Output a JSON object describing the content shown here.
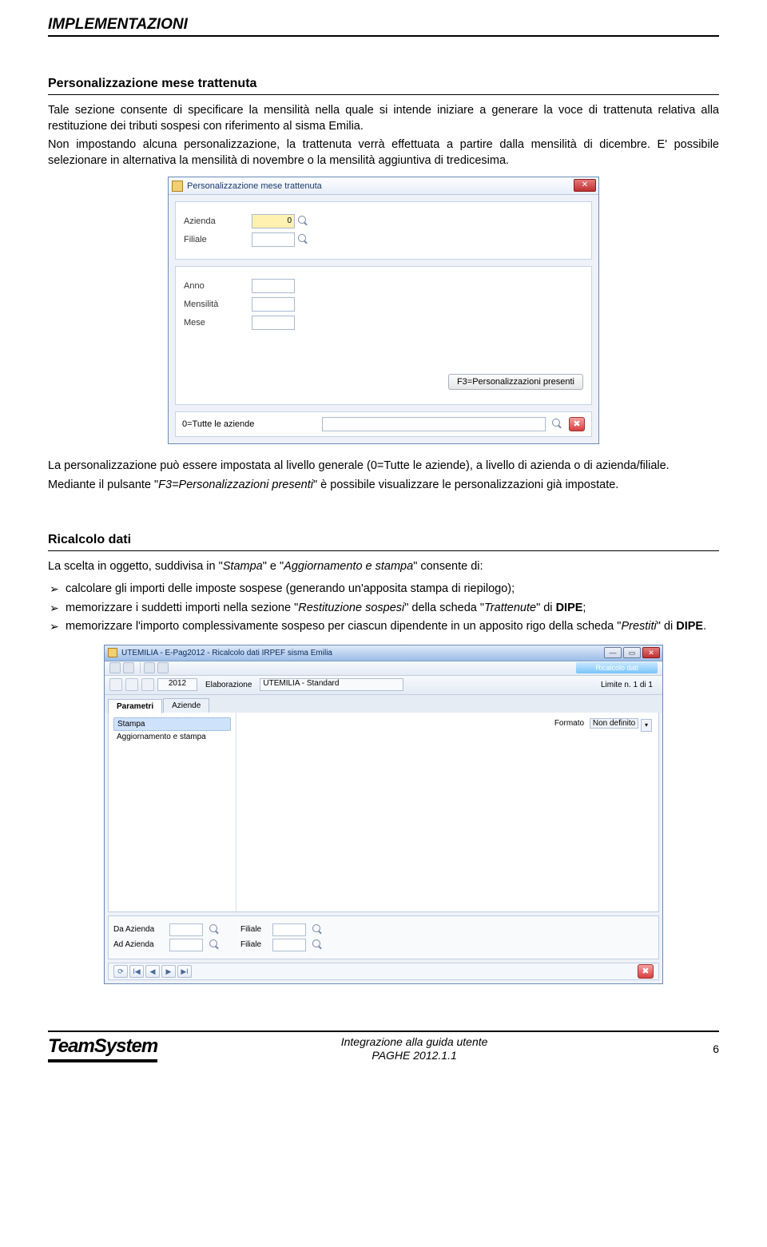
{
  "header": {
    "title": "IMPLEMENTAZIONI"
  },
  "section1": {
    "title": "Personalizzazione mese trattenuta",
    "para1": "Tale sezione consente di specificare la mensilità nella quale si intende iniziare a generare la voce di trattenuta relativa alla restituzione dei tributi sospesi con riferimento al sisma Emilia.",
    "para2": "Non impostando alcuna personalizzazione, la trattenuta verrà effettuata a partire dalla mensilità di dicembre. E' possibile selezionare in alternativa la mensilità di novembre o la mensilità aggiuntiva di tredicesima.",
    "after1": "La personalizzazione può essere impostata al livello generale (0=Tutte le aziende), a livello di azienda o di azienda/filiale.",
    "after2_pre": "Mediante il pulsante \"",
    "after2_btn": "F3=Personalizzazioni presenti",
    "after2_post": "\" è possibile visualizzare le personalizzazioni già impostate."
  },
  "dialog1": {
    "title": "Personalizzazione mese trattenuta",
    "labels": {
      "azienda": "Azienda",
      "filiale": "Filiale",
      "anno": "Anno",
      "mensilita": "Mensilità",
      "mese": "Mese"
    },
    "azienda_value": "0",
    "f3_button": "F3=Personalizzazioni presenti",
    "footer_text": "0=Tutte le aziende"
  },
  "section2": {
    "title": "Ricalcolo dati",
    "intro_pre": "La scelta in oggetto, suddivisa in \"",
    "intro_i1": "Stampa",
    "intro_mid": "\" e \"",
    "intro_i2": "Aggiornamento e stampa",
    "intro_post": "\" consente di:",
    "bullets": {
      "b1": "calcolare gli importi delle imposte sospese (generando un'apposita stampa di riepilogo);",
      "b2_pre": "memorizzare i suddetti importi nella sezione \"",
      "b2_i1": "Restituzione sospesi",
      "b2_mid1": "\" della scheda \"",
      "b2_i2": "Trattenute",
      "b2_mid2": "\" di ",
      "b2_bold": "DIPE",
      "b2_post": ";",
      "b3_pre": "memorizzare l'importo complessivamente sospeso per ciascun dipendente in un apposito rigo della scheda \"",
      "b3_i1": "Prestiti",
      "b3_mid": "\" di ",
      "b3_bold": "DIPE",
      "b3_post": "."
    }
  },
  "dialog2": {
    "title": "UTEMILIA - E-Pag2012 - Ricalcolo dati IRPEF sisma Emilia",
    "ribbon_right": "Ricalcolo dati",
    "toolbar": {
      "year": "2012",
      "elab_label": "Elaborazione",
      "elab_value": "UTEMILIA - Standard",
      "limite": "Limite n. 1 di 1"
    },
    "tabs": {
      "parametri": "Parametri",
      "aziende": "Aziende"
    },
    "tree": {
      "stampa": "Stampa",
      "agg": "Aggiornamento e stampa"
    },
    "formato_label": "Formato",
    "formato_value": "Non definito",
    "bottom": {
      "da_azienda": "Da Azienda",
      "ad_azienda": "Ad Azienda",
      "filiale": "Filiale"
    },
    "nav": {
      "first": "ǀ◀",
      "prev": "◀",
      "next": "▶",
      "last": "▶ǀ"
    }
  },
  "footer": {
    "logo": "TeamSystem",
    "center_line1": "Integrazione alla guida utente",
    "center_line2": "PAGHE 2012.1.1",
    "page": "6"
  }
}
